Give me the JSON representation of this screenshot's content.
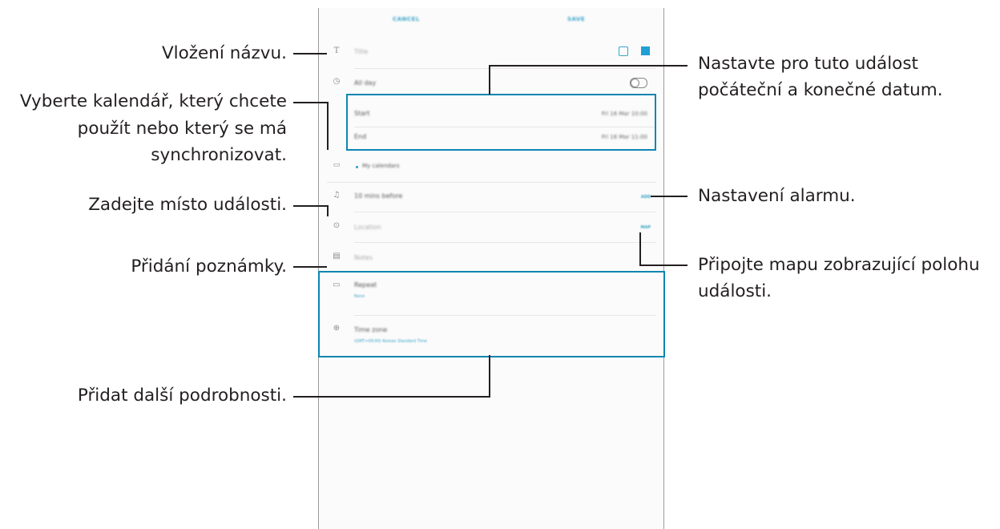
{
  "phone": {
    "cancel_label": "CANCEL",
    "save_label": "SAVE",
    "title_placeholder": "Title",
    "all_day_label": "All day",
    "start_label": "Start",
    "start_value": "Fri 16 Mar   10:00",
    "end_label": "End",
    "end_value": "Fri 16 Mar   11:00",
    "calendar_label": "My calendars",
    "reminder_label": "10 mins before",
    "reminder_action": "ADD",
    "location_placeholder": "Location",
    "map_action": "MAP",
    "notes_placeholder": "Notes",
    "repeat_label": "Repeat",
    "repeat_value": "None",
    "timezone_label": "Time zone",
    "timezone_value": "(GMT+09:00) Korean Standard Time",
    "accent_color": "#3aa4c9",
    "calendar_color": "#1e9fd6"
  },
  "callouts": {
    "title": "Vložení názvu.",
    "calendar_line1": "Vyberte kalendář, který chcete",
    "calendar_line2": "použít nebo který se má",
    "calendar_line3": "synchronizovat.",
    "location": "Zadejte místo události.",
    "notes": "Přidání poznámky.",
    "more": "Přidat další podrobnosti.",
    "dates_line1": "Nastavte pro tuto událost",
    "dates_line2": "počáteční a konečné datum.",
    "alarm": "Nastavení alarmu.",
    "map_line1": "Připojte mapu zobrazující polohu",
    "map_line2": "události."
  },
  "highlight_color": "#0c86b0"
}
